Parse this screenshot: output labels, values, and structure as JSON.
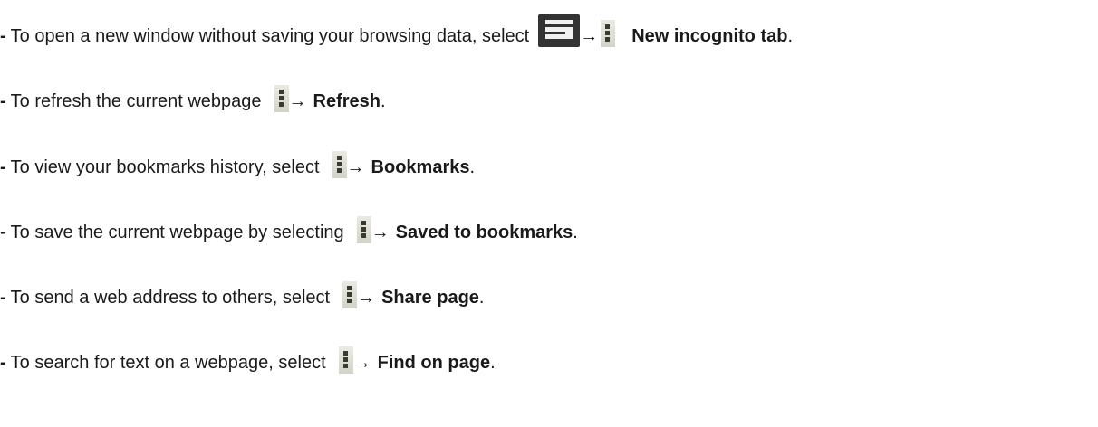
{
  "instructions": [
    {
      "dash": "-",
      "text": "To open a new window without saving your browsing data, select",
      "icon1": "tabs-icon",
      "arrow": "→",
      "icon2": "menu-icon",
      "target": "New incognito tab",
      "end": "."
    },
    {
      "dash": "-",
      "text": "To refresh the current webpage",
      "icon": "menu-icon",
      "arrow": "→",
      "target": "Refresh",
      "end": "."
    },
    {
      "dash": "-",
      "text": "To view your bookmarks history, select",
      "icon": "menu-icon",
      "arrow": "→",
      "target": "Bookmarks",
      "end": "."
    },
    {
      "dash": "-",
      "text": "To save the current webpage by selecting",
      "icon": "menu-icon",
      "arrow": "→",
      "target": "Saved to bookmarks",
      "end": "."
    },
    {
      "dash": "-",
      "text": "To send a web address to others, select",
      "icon": "menu-icon",
      "arrow": "→",
      "target": "Share page",
      "end": "."
    },
    {
      "dash": "-",
      "text": "To search for text on a webpage, select",
      "icon": "menu-icon",
      "arrow": "→",
      "target": "Find on page",
      "end": "."
    }
  ]
}
